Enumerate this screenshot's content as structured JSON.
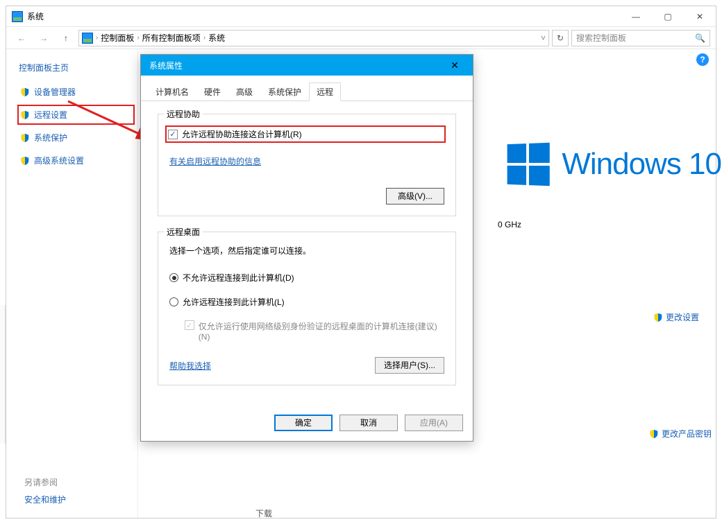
{
  "window": {
    "title": "系统",
    "min": "—",
    "max": "▢",
    "close": "✕",
    "nav_back": "←",
    "nav_fwd": "→",
    "nav_up": "↑",
    "crumb1": "控制面板",
    "crumb2": "所有控制面板项",
    "crumb3": "系统",
    "crumb_sep": "›",
    "dropdown": "˅",
    "refresh": "↻",
    "search_placeholder": "搜索控制面板",
    "search_icon": "🔍",
    "help": "?"
  },
  "sidebar": {
    "heading": "控制面板主页",
    "items": [
      {
        "label": "设备管理器"
      },
      {
        "label": "远程设置"
      },
      {
        "label": "系统保护"
      },
      {
        "label": "高级系统设置"
      }
    ],
    "footer_head": "另请参阅",
    "footer_link": "安全和维护"
  },
  "main": {
    "win10_text": "Windows 10",
    "ghz": "0 GHz",
    "change_settings": "更改设置",
    "change_key": "更改产品密钥"
  },
  "dialog": {
    "title": "系统属性",
    "close": "✕",
    "tabs": [
      "计算机名",
      "硬件",
      "高级",
      "系统保护",
      "远程"
    ],
    "active_tab": 4,
    "ra_group": "远程协助",
    "ra_chk": "允许远程协助连接这台计算机(R)",
    "ra_link": "有关启用远程协助的信息",
    "ra_btn": "高级(V)...",
    "rd_group": "远程桌面",
    "rd_intro": "选择一个选项，然后指定谁可以连接。",
    "rd_radio1": "不允许远程连接到此计算机(D)",
    "rd_radio2": "允许远程连接到此计算机(L)",
    "rd_subchk": "仅允许运行使用网络级别身份验证的远程桌面的计算机连接(建议)(N)",
    "rd_help": "帮助我选择",
    "rd_btn": "选择用户(S)...",
    "ok": "确定",
    "cancel": "取消",
    "apply": "应用(A)"
  },
  "taskbar": {
    "download": "下载"
  }
}
